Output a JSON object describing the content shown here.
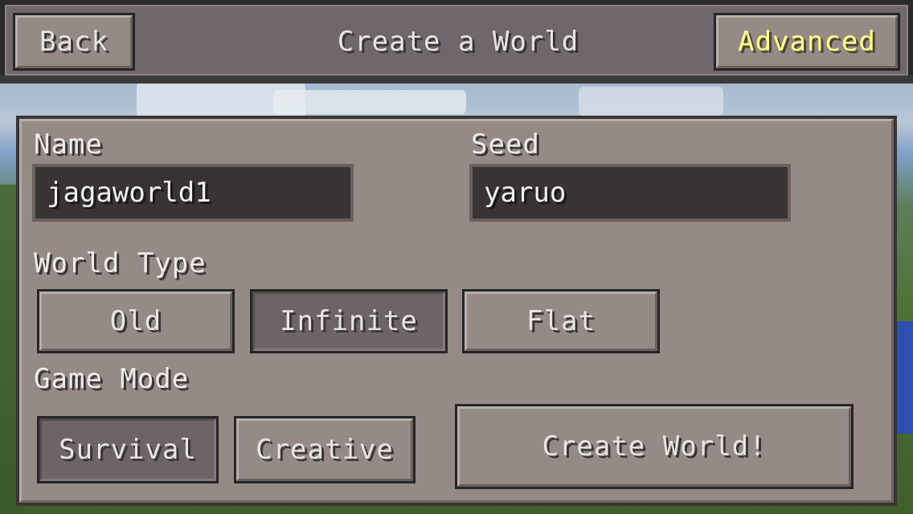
{
  "header": {
    "back_label": "Back",
    "title": "Create a World",
    "advanced_label": "Advanced"
  },
  "form": {
    "name_label": "Name",
    "name_value": "jagaworld1",
    "seed_label": "Seed",
    "seed_value": "yaruo",
    "world_type_label": "World Type",
    "world_types": [
      {
        "label": "Old",
        "selected": false
      },
      {
        "label": "Infinite",
        "selected": true
      },
      {
        "label": "Flat",
        "selected": false
      }
    ],
    "game_mode_label": "Game Mode",
    "game_modes": [
      {
        "label": "Survival",
        "selected": true
      },
      {
        "label": "Creative",
        "selected": false
      }
    ],
    "create_label": "Create World!"
  },
  "colors": {
    "panel": "#968a87",
    "selected_button": "#6e6466",
    "field_bg": "#383434",
    "advanced_text": "#ffff90"
  }
}
